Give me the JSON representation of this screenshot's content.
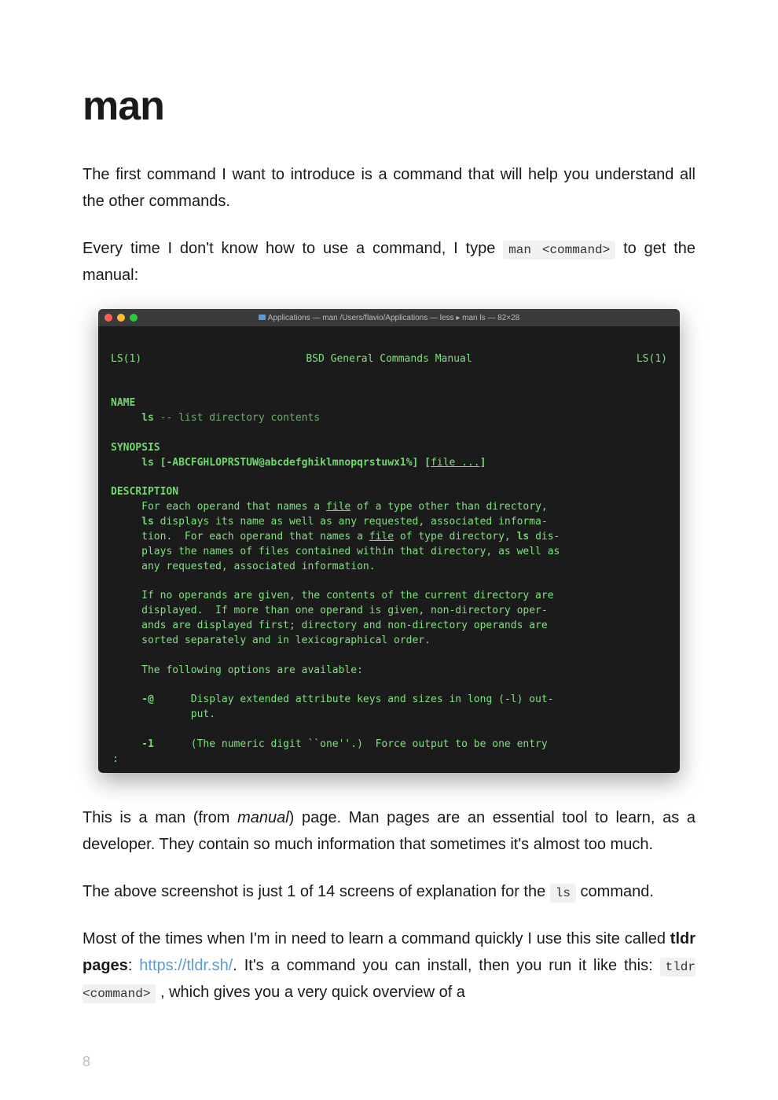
{
  "heading": "man",
  "para1": "The first command I want to introduce is a command that will help you understand all the other commands.",
  "para2a": "Every time I don't know how to use a command, I type ",
  "para2code": "man <command>",
  "para2b": " to get the manual:",
  "terminal": {
    "title": "Applications — man /Users/flavio/Applications — less ▸ man ls — 82×28",
    "h_left": "LS(1)",
    "h_center": "BSD General Commands Manual",
    "h_right": "LS(1)",
    "sec_name": "NAME",
    "name_cmd": "ls",
    "name_dash": " -- ",
    "name_desc": "list directory contents",
    "sec_synopsis": "SYNOPSIS",
    "syn_cmd": "ls",
    "syn_opts": " [-ABCFGHLOPRSTUW@abcdefghiklmnopqrstuwx1%] [",
    "syn_file": "file ...",
    "syn_end": "]",
    "sec_description": "DESCRIPTION",
    "desc_l1a": "For each operand that names a ",
    "desc_l1_file": "file",
    "desc_l1b": " of a type other than directory,",
    "desc_l2a_cmd": "ls",
    "desc_l2a": " displays its name as well as any requested, associated informa-",
    "desc_l3a": "tion.  For each operand that names a ",
    "desc_l3_file": "file",
    "desc_l3b": " of type directory, ",
    "desc_l3_cmd": "ls",
    "desc_l3c": " dis-",
    "desc_l4": "plays the names of files contained within that directory, as well as",
    "desc_l5": "any requested, associated information.",
    "desc_l6": "If no operands are given, the contents of the current directory are",
    "desc_l7": "displayed.  If more than one operand is given, non-directory oper-",
    "desc_l8": "ands are displayed first; directory and non-directory operands are",
    "desc_l9": "sorted separately and in lexicographical order.",
    "desc_l10": "The following options are available:",
    "opt1_flag": "-@",
    "opt1_l1": "Display extended attribute keys and sizes in long (-l) out-",
    "opt1_l2": "put.",
    "opt2_flag": "-1",
    "opt2_l1": "(The numeric digit ``one''.)  Force output to be one entry",
    "prompt": ":"
  },
  "para3a": "This is a man (from ",
  "para3i": "manual",
  "para3b": ") page. Man pages are an essential tool to learn, as a developer. They contain so much information that sometimes it's almost too much.",
  "para4a": "The above screenshot is just 1 of 14 screens of explanation for the ",
  "para4code": "ls",
  "para4b": " command.",
  "para5a": "Most of the times when I'm in need to learn a command quickly I use this site called ",
  "para5bold": "tldr pages",
  "para5colon": ": ",
  "para5link": "https://tldr.sh/",
  "para5b": ". It's a command you can install, then you run it like this: ",
  "para5code": "tldr <command>",
  "para5c": " , which gives you a very quick overview of a",
  "pageNumber": "8"
}
